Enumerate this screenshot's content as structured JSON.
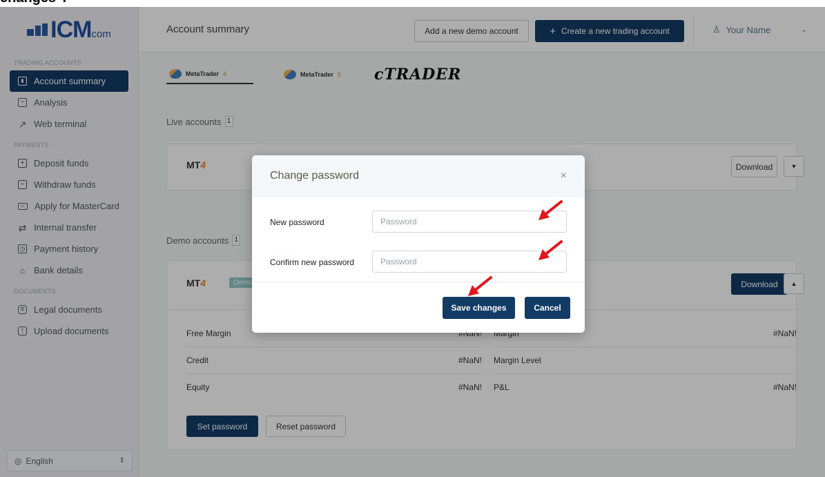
{
  "caption": "changes\".",
  "sidebar": {
    "logo": {
      "main": "ICM",
      "suffix": "com"
    },
    "sections": {
      "trading": "TRADING ACCOUNTS",
      "payments": "PAYMENTS",
      "documents": "DOCUMENTS"
    },
    "items": [
      {
        "label": "Account summary",
        "icon": "chart-icon",
        "glyph": "▮"
      },
      {
        "label": "Analysis",
        "icon": "analysis-icon",
        "glyph": "~"
      },
      {
        "label": "Web terminal",
        "icon": "external-link-icon",
        "glyph": "↗"
      },
      {
        "label": "Deposit funds",
        "icon": "deposit-icon",
        "glyph": "+"
      },
      {
        "label": "Withdraw funds",
        "icon": "withdraw-icon",
        "glyph": "−"
      },
      {
        "label": "Apply for MasterCard",
        "icon": "card-icon",
        "glyph": "▭"
      },
      {
        "label": "Internal transfer",
        "icon": "transfer-icon",
        "glyph": "⇄"
      },
      {
        "label": "Payment history",
        "icon": "history-icon",
        "glyph": "◷"
      },
      {
        "label": "Bank details",
        "icon": "bank-icon",
        "glyph": "🏛"
      },
      {
        "label": "Legal documents",
        "icon": "document-icon",
        "glyph": "≡"
      },
      {
        "label": "Upload documents",
        "icon": "upload-icon",
        "glyph": "↑"
      }
    ],
    "language": "English"
  },
  "header": {
    "title": "Account summary",
    "add_demo": "Add a new demo account",
    "create_trading": "Create a new trading account",
    "create_plus": "+",
    "user": "Your Name"
  },
  "platforms": [
    {
      "label": "MetaTrader",
      "version": "4"
    },
    {
      "label": "MetaTrader",
      "version": "5"
    },
    {
      "label": "cTRADER"
    }
  ],
  "live": {
    "label": "Live accounts",
    "count": "1",
    "platform": "MT",
    "platform_version": "4",
    "download": "Download"
  },
  "demo": {
    "label": "Demo accounts",
    "count": "1",
    "platform": "MT",
    "platform_version": "4",
    "badge": "Demo",
    "download": "Download",
    "rows": [
      {
        "left_label": "Free Margin",
        "left_value": "#NaN!",
        "right_label": "Margin",
        "right_value": "#NaN!"
      },
      {
        "left_label": "Credit",
        "left_value": "#NaN!",
        "right_label": "Margin Level",
        "right_value": ""
      },
      {
        "left_label": "Equity",
        "left_value": "#NaN!",
        "right_label": "P&L",
        "right_value": "#NaN!"
      }
    ],
    "set_password": "Set password",
    "reset_password": "Reset password"
  },
  "modal": {
    "title": "Change password",
    "close": "×",
    "new_password_label": "New password",
    "new_password_placeholder": "Password",
    "confirm_label": "Confirm new password",
    "confirm_placeholder": "Password",
    "save": "Save changes",
    "cancel": "Cancel"
  },
  "colors": {
    "primary": "#123b66",
    "arrow": "#e3141b",
    "mt4_accent": "#e4872d"
  }
}
